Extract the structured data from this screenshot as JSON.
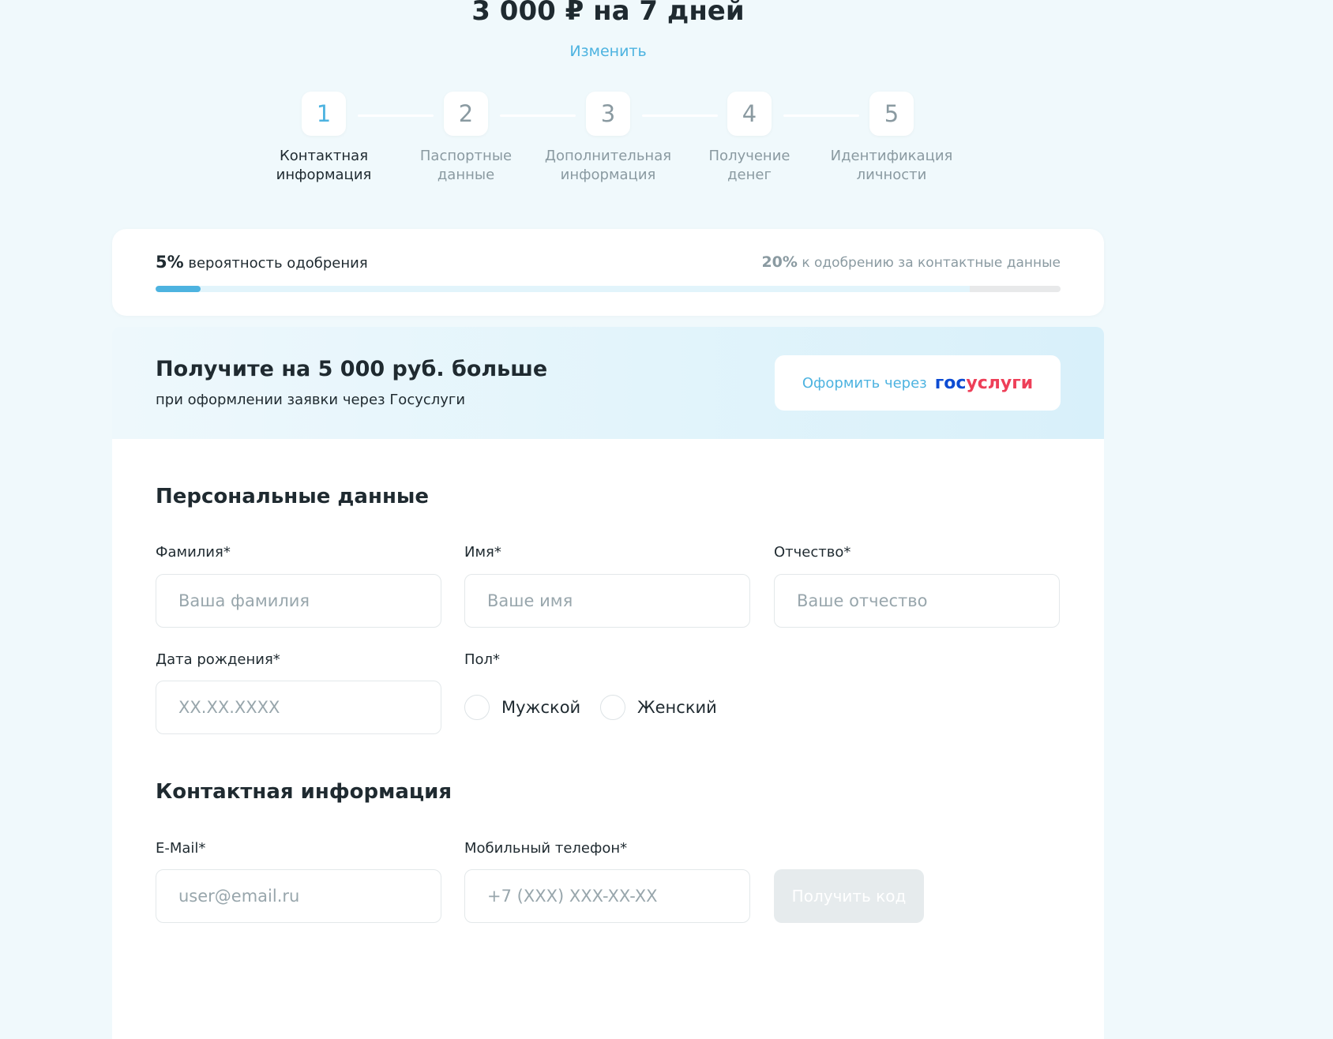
{
  "header": {
    "loan_title": "3 000 ₽ на 7 дней",
    "change_link": "Изменить"
  },
  "steps": [
    {
      "number": "1",
      "label_line1": "Контактная",
      "label_line2": "информация",
      "active": true
    },
    {
      "number": "2",
      "label_line1": "Паспортные",
      "label_line2": "данные",
      "active": false
    },
    {
      "number": "3",
      "label_line1": "Дополнительная",
      "label_line2": "информация",
      "active": false
    },
    {
      "number": "4",
      "label_line1": "Получение",
      "label_line2": "денег",
      "active": false
    },
    {
      "number": "5",
      "label_line1": "Идентификация",
      "label_line2": "личности",
      "active": false
    }
  ],
  "approval": {
    "current_percent": "5%",
    "current_text": " вероятность одобрения",
    "bonus_percent": "20%",
    "bonus_text": " к одобрению за контактные данные",
    "progress_fraction": 0.05,
    "progress_target_fraction": 0.9
  },
  "gosuslugi": {
    "title": "Получите на 5 000 руб. больше",
    "subtitle": "при оформлении заявки через Госуслуги",
    "button_label": "Оформить через",
    "logo_part1": "гос",
    "logo_part2": "услуги"
  },
  "personal": {
    "section_title": "Персональные данные",
    "surname_label": "Фамилия*",
    "surname_placeholder": "Ваша фамилия",
    "name_label": "Имя*",
    "name_placeholder": "Ваше имя",
    "patronymic_label": "Отчество*",
    "patronymic_placeholder": "Ваше отчество",
    "birthdate_label": "Дата рождения*",
    "birthdate_placeholder": "XX.XX.XXXX",
    "gender_label": "Пол*",
    "gender_male": "Мужской",
    "gender_female": "Женский"
  },
  "contact": {
    "section_title": "Контактная информация",
    "email_label": "E-Mail*",
    "email_placeholder": "user@email.ru",
    "phone_label": "Мобильный телефон*",
    "phone_placeholder": "+7 (XXX) XXX-XX-XX",
    "get_code_button": "Получить код"
  },
  "colors": {
    "accent": "#4db3e0",
    "gos_blue": "#0d4cd3",
    "gos_red": "#ee3f58"
  }
}
